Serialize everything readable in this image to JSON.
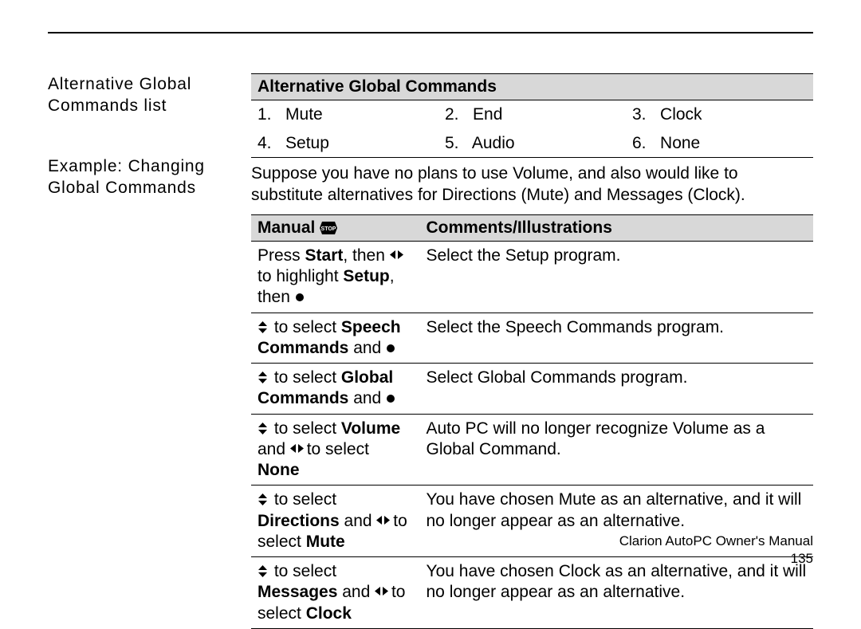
{
  "side": {
    "heading1": "Alternative Global Commands list",
    "heading2": "Example: Changing Global Commands"
  },
  "commands": {
    "header": "Alternative Global Commands",
    "items": [
      {
        "n": "1.",
        "label": "Mute"
      },
      {
        "n": "2.",
        "label": "End"
      },
      {
        "n": "3.",
        "label": "Clock"
      },
      {
        "n": "4.",
        "label": "Setup"
      },
      {
        "n": "5.",
        "label": "Audio"
      },
      {
        "n": "6.",
        "label": "None"
      }
    ]
  },
  "intro": "Suppose you have no plans to use Volume, and also would like to substitute alternatives for Directions (Mute) and Messages (Clock).",
  "steps_header": {
    "manual": "Manual",
    "comments": "Comments/Illustrations"
  },
  "steps": [
    {
      "m_pre": "Press ",
      "m_b1": "Start",
      "m_mid1": ", then ",
      "m_icon1": "leftright",
      "m_mid2": " to highlight ",
      "m_b2": "Setup",
      "m_mid3": ", then ",
      "m_icon2": "dot",
      "m_post": "",
      "comment": "Select the Setup program."
    },
    {
      "m_pre": "",
      "m_icon1": "updown",
      "m_mid1": " to select ",
      "m_b1": "Speech Commands",
      "m_mid2": " and ",
      "m_icon2": "dot",
      "m_post": "",
      "comment": "Select the Speech Commands program."
    },
    {
      "m_pre": "",
      "m_icon1": "updown",
      "m_mid1": " to select ",
      "m_b1": "Global Commands",
      "m_mid2": " and ",
      "m_icon2": "dot",
      "m_post": "",
      "comment": "Select Global Commands program."
    },
    {
      "m_pre": "",
      "m_icon1": "updown",
      "m_mid1": " to select ",
      "m_b1": "Volume",
      "m_mid2": " and ",
      "m_icon2": "leftright",
      "m_mid3": " to select ",
      "m_b2": "None",
      "m_post": "",
      "comment": "Auto PC will no longer recognize Volume as a Global Command."
    },
    {
      "m_pre": "",
      "m_icon1": "updown",
      "m_mid1": " to select ",
      "m_b1": "Directions",
      "m_mid2": " and ",
      "m_icon2": "leftright",
      "m_mid3": " to select ",
      "m_b2": "Mute",
      "m_post": "",
      "comment": "You have chosen Mute as an alternative, and it will no longer appear as an alternative."
    },
    {
      "m_pre": "",
      "m_icon1": "updown",
      "m_mid1": " to select ",
      "m_b1": "Messages",
      "m_mid2": " and ",
      "m_icon2": "leftright",
      "m_mid3": " to select ",
      "m_b2": "Clock",
      "m_post": "",
      "comment": "You have chosen Clock as an alternative, and it will no longer appear as an alternative."
    }
  ],
  "footer": {
    "title": "Clarion AutoPC Owner's Manual",
    "page": "135"
  }
}
